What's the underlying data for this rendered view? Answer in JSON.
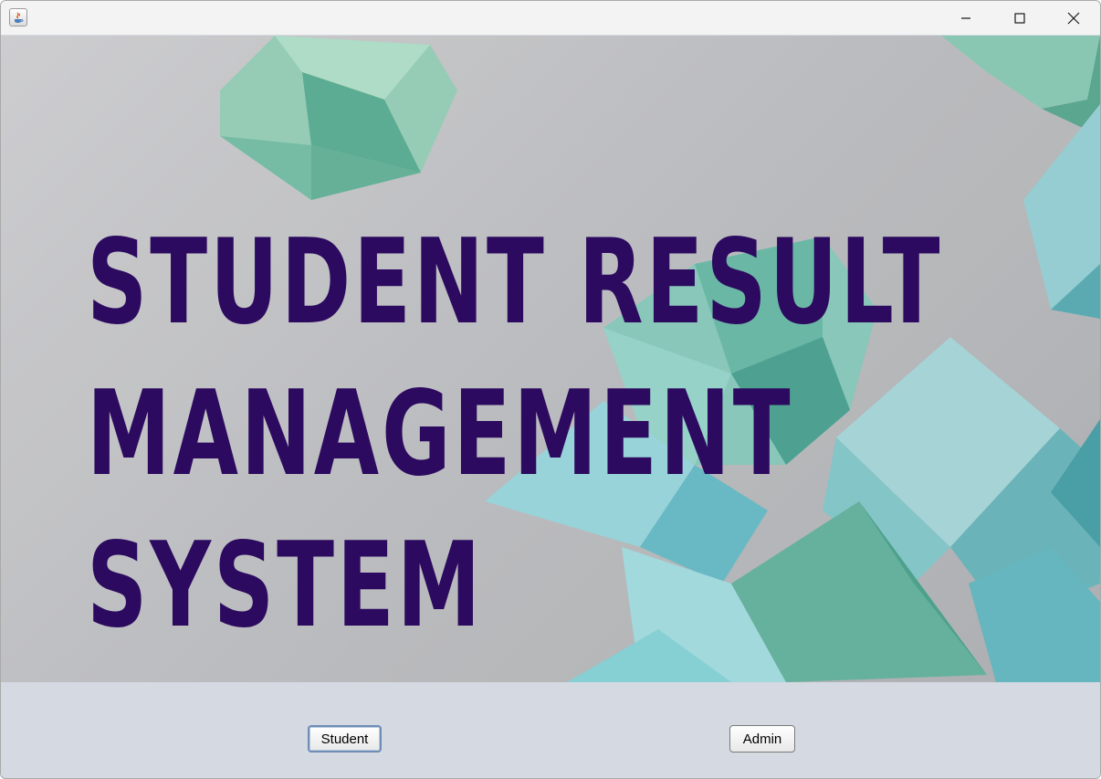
{
  "window": {
    "title": "",
    "controls": [
      "minimize-icon",
      "maximize-icon",
      "close-icon"
    ]
  },
  "banner": {
    "title_lines": [
      "STUDENT RESULT",
      "MANAGEMENT",
      "SYSTEM"
    ],
    "title_color": "#2c0a5f"
  },
  "actions": {
    "student_label": "Student",
    "admin_label": "Admin"
  }
}
